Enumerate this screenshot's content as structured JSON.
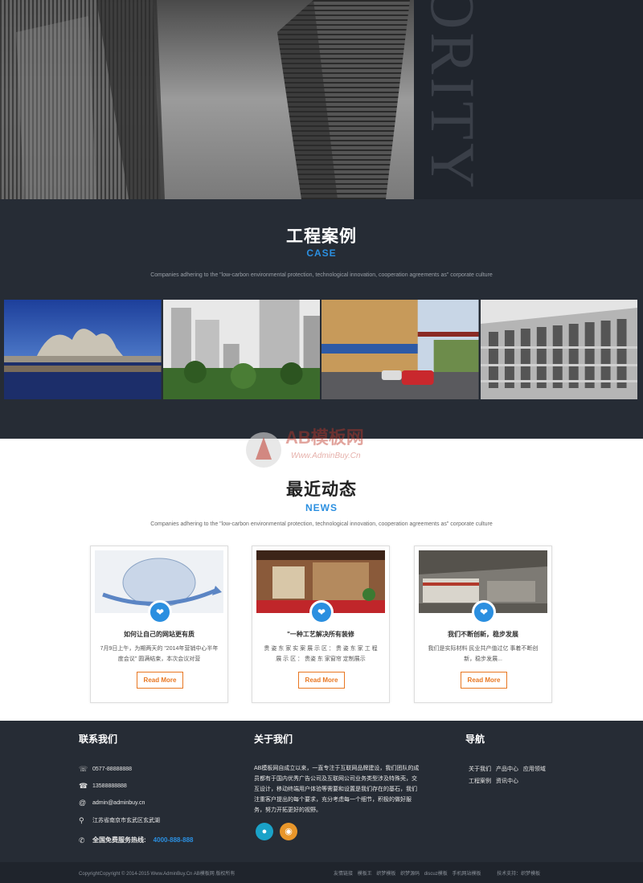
{
  "hero": {
    "vertical_word": "ORITY"
  },
  "case_section": {
    "title_cn": "工程案例",
    "title_en": "CASE",
    "description": "Companies adhering to the \"low-carbon environmental protection, technological innovation, cooperation agreements as\" corporate culture",
    "images": [
      "guggenheim-museum-photo",
      "residential-towers-photo",
      "street-shops-photo",
      "office-building-photo"
    ]
  },
  "watermark": {
    "text": "AB模板网",
    "url": "Www.AdminBuy.Cn"
  },
  "news_section": {
    "title_cn": "最近动态",
    "title_en": "NEWS",
    "description": "Companies adhering to the \"low-carbon environmental protection, technological innovation, cooperation agreements as\" corporate culture",
    "cards": [
      {
        "title": "如何让自己的网站更有质",
        "body": "7月9日上午，为期两天的 \"2014年营销中心半年度会议\" 圆满结束，本次会议对营",
        "button": "Read More"
      },
      {
        "title": "\"一种工艺解决所有装修",
        "body": "贵 姿 东 家 实 案 展 示 区 ： 贵 姿 东 家 工 程 展 示 区 ： 贵姿 东 家窗帘 定制展示",
        "button": "Read More"
      },
      {
        "title": "我们不断创新，稳步发展",
        "body": "我们是实际材料 民业共产值过亿 事着不断创新，稳步发展...",
        "button": "Read More"
      }
    ]
  },
  "footer": {
    "contact": {
      "title": "联系我们",
      "phone1": "0577-88888888",
      "phone2": "13588888888",
      "email": "admin@adminbuy.cn",
      "address": "江苏省南京市玄武区玄武湖",
      "hotline_label": "全国免费服务热线:",
      "hotline_number": "4000-888-888"
    },
    "about": {
      "title": "关于我们",
      "text": "AB模板网自成立以来，一直专注于互联网品牌建设，我们团队的成员都有于国内优秀广告公司及互联网公司业务类型涉及特殊壳，交互设计，移动终端用户体验等需要和设置是我们存在的基石，我们注重客户提出的每个要求，充分考虑每一个细节，积极的做好服务，努力开拓更好的视野。"
    },
    "nav": {
      "title": "导航",
      "links": [
        "关于我们",
        "产品中心",
        "应用领域",
        "工程案例",
        "资讯中心"
      ]
    },
    "copyright": "CopyrightCopyright © 2014-2015 Www.AdminBuy.Cn AB模板网 版权所有",
    "bottom_links": [
      "友情链接",
      "模板王",
      "织梦模板",
      "织梦源码",
      "discuz模板",
      "手机网站模板",
      "技术支持：织梦模板"
    ]
  },
  "colors": {
    "accent_blue": "#2b8fe0",
    "accent_orange": "#e87722",
    "dark_bg": "#262c35"
  }
}
